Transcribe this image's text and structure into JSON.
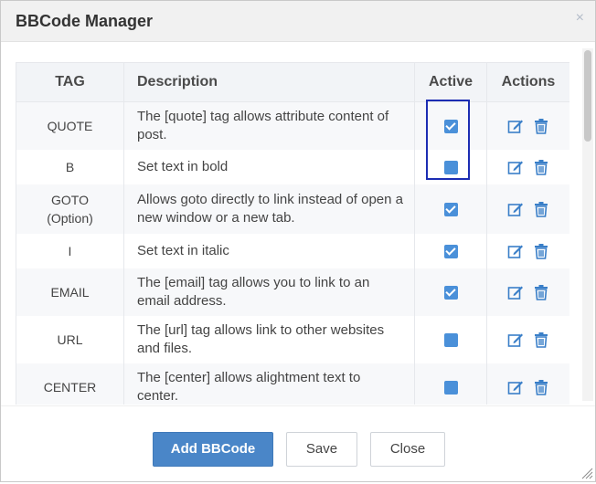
{
  "dialog": {
    "title": "BBCode Manager",
    "close_glyph": "×"
  },
  "table": {
    "headers": {
      "tag": "TAG",
      "description": "Description",
      "active": "Active",
      "actions": "Actions"
    },
    "rows": [
      {
        "tag": "QUOTE",
        "tag_sub": "",
        "description": "The [quote] tag allows attribute content of post.",
        "active": true
      },
      {
        "tag": "B",
        "tag_sub": "",
        "description": "Set text in bold",
        "active": false
      },
      {
        "tag": "GOTO",
        "tag_sub": "(Option)",
        "description": "Allows goto directly to link instead of open a new window or a new tab.",
        "active": true
      },
      {
        "tag": "I",
        "tag_sub": "",
        "description": "Set text in italic",
        "active": true
      },
      {
        "tag": "EMAIL",
        "tag_sub": "",
        "description": "The [email] tag allows you to link to an email address.",
        "active": true
      },
      {
        "tag": "URL",
        "tag_sub": "",
        "description": "The [url] tag allows link to other websites and files.",
        "active": false
      },
      {
        "tag": "CENTER",
        "tag_sub": "",
        "description": "The [center] allows alightment text to center.",
        "active": false
      }
    ],
    "action_icons": [
      "edit-icon",
      "trash-icon"
    ]
  },
  "footer": {
    "add_label": "Add BBCode",
    "save_label": "Save",
    "close_label": "Close"
  },
  "colors": {
    "accent": "#4a86c8",
    "checkbox": "#4a90d9",
    "highlight": "#1c2db3"
  }
}
